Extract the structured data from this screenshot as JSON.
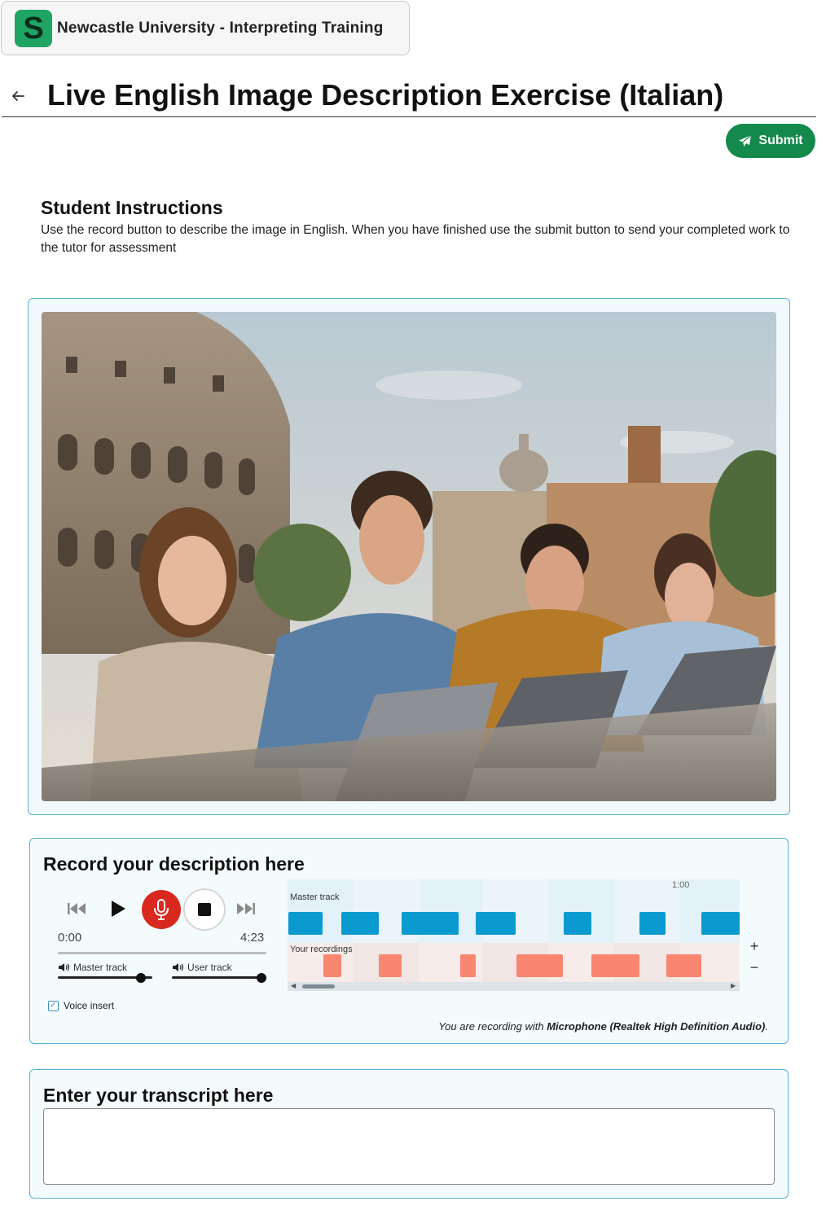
{
  "app": {
    "logo_letter": "S",
    "name": "Newcastle University - Interpreting Training",
    "brand_color": "#1fa463"
  },
  "page": {
    "title": "Live English Image Description Exercise (Italian)",
    "submit_label": "Submit"
  },
  "instructions": {
    "heading": "Student Instructions",
    "text": "Use the record button to describe the image in English. When you have finished use the submit button to send your completed work to the tutor for assessment"
  },
  "recorder": {
    "heading": "Record your description here",
    "current_time": "0:00",
    "total_time": "4:23",
    "progress": 0,
    "master_track_label": "Master track",
    "user_track_label": "User track",
    "master_volume": 0.88,
    "user_volume": 0.95,
    "timeline": {
      "time_marker": "1:00",
      "master_lane_label": "Master track",
      "user_lane_label": "Your recordings"
    },
    "voice_insert_label": "Voice insert",
    "voice_insert_checked": true,
    "mic_prefix": "You are recording with ",
    "mic_device": "Microphone (Realtek High Definition Audio)",
    "mic_suffix": "."
  },
  "transcript": {
    "heading": "Enter your transcript here",
    "value": "",
    "placeholder": ""
  },
  "colors": {
    "accent": "#5ab1d4",
    "submit": "#138a4b",
    "record": "#d9281e",
    "master_clip": "#0a9ad0",
    "user_clip": "#f98671"
  },
  "icons": {
    "back": "arrow-left-icon",
    "submit": "paper-plane-icon",
    "skip_back": "skip-back-icon",
    "play": "play-icon",
    "record": "microphone-icon",
    "stop": "stop-icon",
    "skip_forward": "skip-forward-icon",
    "speaker": "speaker-icon",
    "zoom_in": "plus-icon",
    "zoom_out": "minus-icon"
  }
}
